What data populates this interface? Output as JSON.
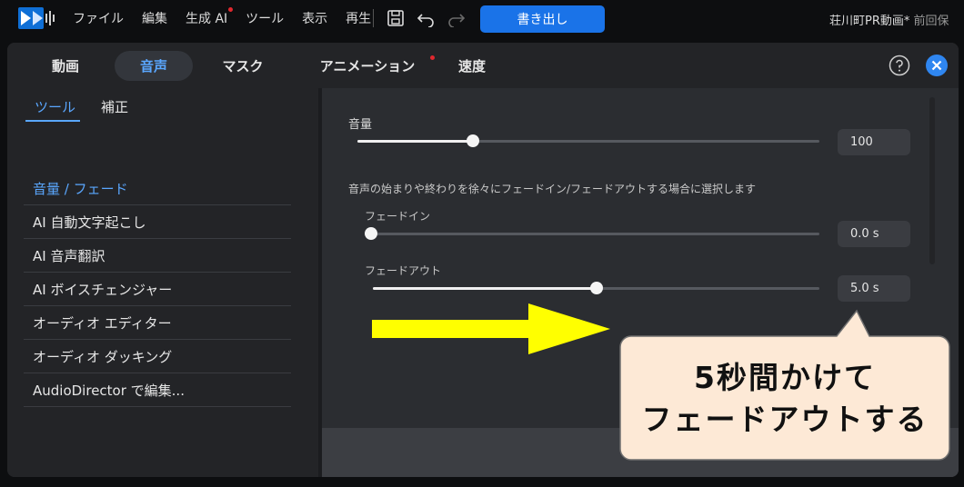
{
  "app": {
    "menu": [
      "ファイル",
      "編集",
      "生成 AI",
      "ツール",
      "表示",
      "再生"
    ],
    "export_label": "書き出し",
    "project_title": "荘川町PR動画*",
    "project_sub": "前回保"
  },
  "tabs": [
    "動画",
    "音声",
    "マスク",
    "アニメーション",
    "速度"
  ],
  "active_tab": "音声",
  "left": {
    "subtabs": [
      "ツール",
      "補正"
    ],
    "tools": [
      "音量 / フェード",
      "AI 自動文字起こし",
      "AI 音声翻訳",
      "AI ボイスチェンジャー",
      "オーディオ エディター",
      "オーディオ ダッキング",
      "AudioDirector で編集..."
    ]
  },
  "volume": {
    "label": "音量",
    "value": "100",
    "level": 0.25
  },
  "fade_description": "音声の始まりや終わりを徐々にフェードイン/フェードアウトする場合に選択します",
  "fade_in": {
    "label": "フェードイン",
    "value": "0.0 s",
    "level": 0.0
  },
  "fade_out": {
    "label": "フェードアウト",
    "value": "5.0 s",
    "level": 0.5
  },
  "annotation": {
    "line1": "5秒間かけて",
    "line2": "フェードアウトする"
  },
  "colors": {
    "accent": "#5aa7ff",
    "export_button": "#1a73e8",
    "callout_fill": "#fde9d6",
    "arrow": "#ffff00"
  }
}
